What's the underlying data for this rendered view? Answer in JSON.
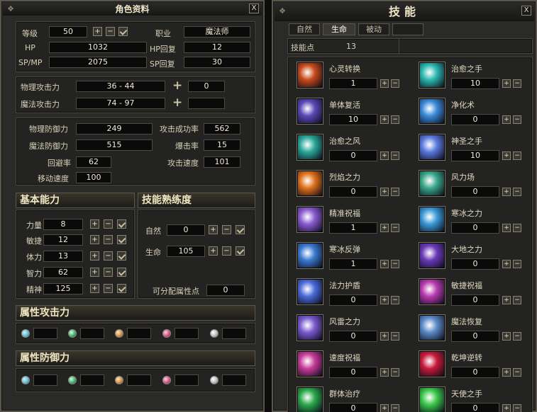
{
  "character": {
    "title": "角色资料",
    "close": "X",
    "level": {
      "label": "等级",
      "value": "50"
    },
    "job": {
      "label": "职业",
      "value": "魔法师"
    },
    "hp": {
      "label": "HP",
      "value": "1032"
    },
    "hp_regen": {
      "label": "HP回复",
      "value": "12"
    },
    "spmp": {
      "label": "SP/MP",
      "value": "2075"
    },
    "sp_regen": {
      "label": "SP回复",
      "value": "30"
    },
    "phys_atk": {
      "label": "物理攻击力",
      "value": "36 - 44",
      "bonus": "0"
    },
    "mag_atk": {
      "label": "魔法攻击力",
      "value": "74 - 97",
      "bonus": ""
    },
    "phys_def": {
      "label": "物理防御力",
      "value": "249"
    },
    "mag_def": {
      "label": "魔法防御力",
      "value": "515"
    },
    "evasion": {
      "label": "回避率",
      "value": "62"
    },
    "move_speed": {
      "label": "移动速度",
      "value": "100"
    },
    "hit_rate": {
      "label": "攻击成功率",
      "value": "562"
    },
    "crit_rate": {
      "label": "爆击率",
      "value": "15"
    },
    "atk_speed": {
      "label": "攻击速度",
      "value": "101"
    },
    "basic_header": "基本能力",
    "skill_mastery_header": "技能熟练度",
    "basic_stats": [
      {
        "label": "力量",
        "value": "8"
      },
      {
        "label": "敏捷",
        "value": "12"
      },
      {
        "label": "体力",
        "value": "13"
      },
      {
        "label": "智力",
        "value": "62"
      },
      {
        "label": "精神",
        "value": "125"
      }
    ],
    "mastery": [
      {
        "label": "自然",
        "value": "0"
      },
      {
        "label": "生命",
        "value": "105"
      }
    ],
    "free_points": {
      "label": "可分配属性点",
      "value": "0"
    },
    "elem_atk_header": "属性攻击力",
    "elem_def_header": "属性防御力",
    "element_colors": [
      "#5ab8d0",
      "#3ea86a",
      "#d08a3a",
      "#d04a7a",
      "#b8b8b8"
    ]
  },
  "skills": {
    "title": "技能",
    "close": "X",
    "tabs": [
      "自然",
      "生命",
      "被动",
      ""
    ],
    "active_tab": 1,
    "points": {
      "label": "技能点",
      "value": "13"
    },
    "left": [
      {
        "name": "心灵转换",
        "level": "1",
        "icon": "mind-convert-icon",
        "color": "#c84a1a"
      },
      {
        "name": "单体复活",
        "level": "10",
        "icon": "single-revive-icon",
        "color": "#5a48b8"
      },
      {
        "name": "治愈之风",
        "level": "0",
        "icon": "healing-wind-icon",
        "color": "#2aa89a"
      },
      {
        "name": "烈焰之力",
        "level": "0",
        "icon": "flame-power-icon",
        "color": "#e0701a"
      },
      {
        "name": "精准祝福",
        "level": "1",
        "icon": "precision-bless-icon",
        "color": "#8a5ad0"
      },
      {
        "name": "寒冰反弹",
        "level": "1",
        "icon": "ice-reflect-icon",
        "color": "#3a7ad0"
      },
      {
        "name": "法力护盾",
        "level": "0",
        "icon": "mana-shield-icon",
        "color": "#4a6ad8"
      },
      {
        "name": "风雷之力",
        "level": "0",
        "icon": "wind-thunder-icon",
        "color": "#7a5ad0"
      },
      {
        "name": "速度祝福",
        "level": "0",
        "icon": "speed-bless-icon",
        "color": "#c83a9a"
      },
      {
        "name": "群体治疗",
        "level": "0",
        "icon": "group-heal-icon",
        "color": "#2aa84a"
      }
    ],
    "right": [
      {
        "name": "治愈之手",
        "level": "10",
        "icon": "healing-hand-icon",
        "color": "#2ab8b0"
      },
      {
        "name": "净化术",
        "level": "0",
        "icon": "purify-icon",
        "color": "#3a8ad8"
      },
      {
        "name": "神圣之手",
        "level": "10",
        "icon": "holy-hand-icon",
        "color": "#5a7ae0"
      },
      {
        "name": "风力场",
        "level": "0",
        "icon": "wind-field-icon",
        "color": "#3aa88a"
      },
      {
        "name": "寒冰之力",
        "level": "0",
        "icon": "ice-power-icon",
        "color": "#3a9ad8"
      },
      {
        "name": "大地之力",
        "level": "0",
        "icon": "earth-power-icon",
        "color": "#6a3ab8"
      },
      {
        "name": "敏捷祝福",
        "level": "0",
        "icon": "agility-bless-icon",
        "color": "#b83ab0"
      },
      {
        "name": "魔法恢复",
        "level": "0",
        "icon": "magic-recover-icon",
        "color": "#5a8ac8"
      },
      {
        "name": "乾坤逆转",
        "level": "0",
        "icon": "reversal-icon",
        "color": "#c81a3a"
      },
      {
        "name": "天使之手",
        "level": "0",
        "icon": "angel-hand-icon",
        "color": "#3ac84a"
      }
    ]
  }
}
